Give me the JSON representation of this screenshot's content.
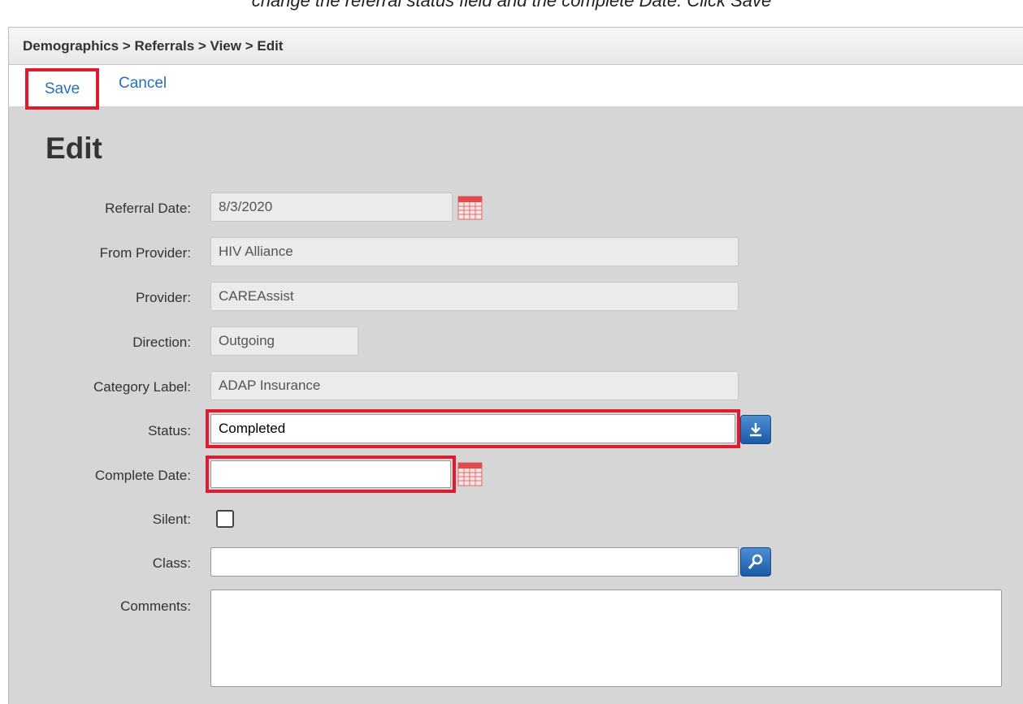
{
  "caption": "change the referral status field and the complete Date. Click Save",
  "breadcrumb": "Demographics > Referrals > View > Edit",
  "actions": {
    "save": "Save",
    "cancel": "Cancel"
  },
  "page_title": "Edit",
  "fields": {
    "referral_date": {
      "label": "Referral Date:",
      "value": "8/3/2020"
    },
    "from_provider": {
      "label": "From Provider:",
      "value": "HIV Alliance"
    },
    "provider": {
      "label": "Provider:",
      "value": "CAREAssist"
    },
    "direction": {
      "label": "Direction:",
      "value": "Outgoing"
    },
    "category_label": {
      "label": "Category Label:",
      "value": "ADAP Insurance"
    },
    "status": {
      "label": "Status:",
      "value": "Completed"
    },
    "complete_date": {
      "label": "Complete Date:",
      "value": ""
    },
    "silent": {
      "label": "Silent:",
      "checked": false
    },
    "class": {
      "label": "Class:",
      "value": ""
    },
    "comments": {
      "label": "Comments:",
      "value": ""
    }
  },
  "colors": {
    "highlight": "#e01b2f",
    "link": "#2a6ebb",
    "panel": "#d6d6d6",
    "button": "#1a5aa6"
  },
  "icons": {
    "calendar": "calendar-icon",
    "dropdown": "download-arrow-icon",
    "lookup": "search-icon"
  }
}
